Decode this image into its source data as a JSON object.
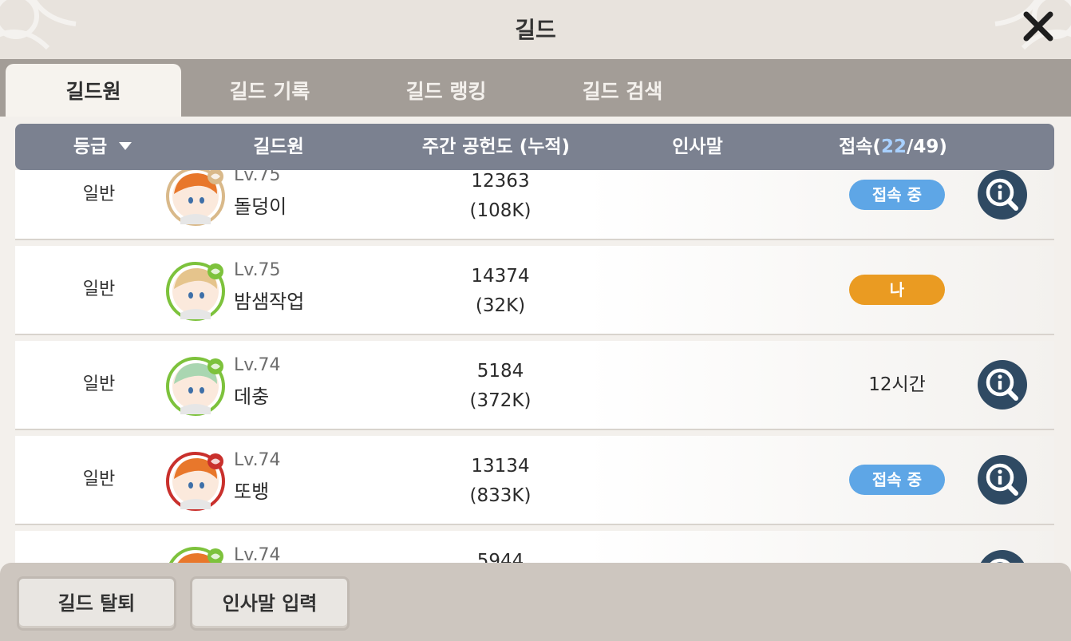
{
  "window": {
    "title": "길드"
  },
  "tabs": [
    {
      "label": "길드원",
      "active": true
    },
    {
      "label": "길드 기록",
      "active": false
    },
    {
      "label": "길드 랭킹",
      "active": false
    },
    {
      "label": "길드 검색",
      "active": false
    }
  ],
  "table": {
    "headers": {
      "grade": "등급",
      "member": "길드원",
      "contribution": "주간 공헌도 (누적)",
      "greeting": "인사말",
      "online_label": "접속(",
      "online_count": "22",
      "online_total": "/49)"
    },
    "rows": [
      {
        "grade": "일반",
        "level": "Lv.75",
        "name": "돌덩이",
        "weekly": "12363",
        "total": "(108K)",
        "status": "접속 중",
        "status_type": "online",
        "frame_color": "#d9b98a",
        "hair_color": "#e8772b",
        "has_info": true
      },
      {
        "grade": "일반",
        "level": "Lv.75",
        "name": "밤샘작업",
        "weekly": "14374",
        "total": "(32K)",
        "status": "나",
        "status_type": "me",
        "frame_color": "#7dc23c",
        "hair_color": "#e5c48c",
        "has_info": false
      },
      {
        "grade": "일반",
        "level": "Lv.74",
        "name": "데충",
        "weekly": "5184",
        "total": "(372K)",
        "status": "12시간",
        "status_type": "text",
        "frame_color": "#7dc23c",
        "hair_color": "#a9d6b1",
        "has_info": true
      },
      {
        "grade": "일반",
        "level": "Lv.74",
        "name": "또뱅",
        "weekly": "13134",
        "total": "(833K)",
        "status": "접속 중",
        "status_type": "online",
        "frame_color": "#c9302c",
        "hair_color": "#e8772b",
        "has_info": true
      },
      {
        "grade": "",
        "level": "Lv.74",
        "name": "",
        "weekly": "5944",
        "total": "",
        "status": "",
        "status_type": "text",
        "frame_color": "#7dc23c",
        "hair_color": "#e8772b",
        "has_info": true
      }
    ]
  },
  "footer": {
    "leave_label": "길드 탈퇴",
    "greeting_label": "인사말 입력"
  },
  "colors": {
    "online": "#5ea6e6",
    "me": "#ea9b22",
    "header_bg": "#7b8190",
    "info_icon": "#2f4a63"
  }
}
